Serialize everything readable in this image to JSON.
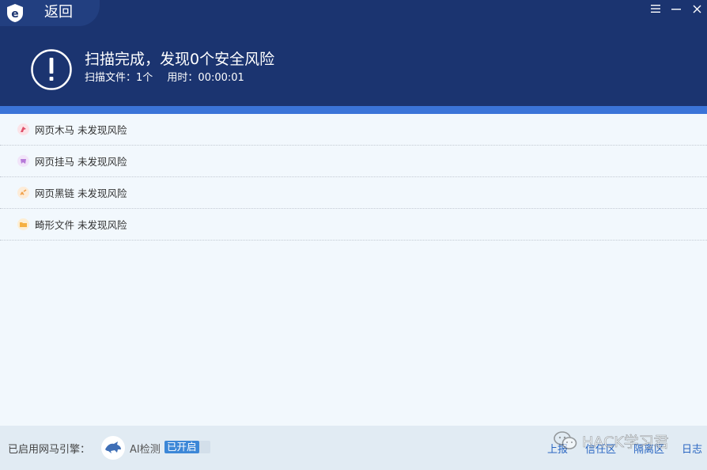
{
  "header": {
    "back_label": "返回",
    "title": "扫描完成，发现0个安全风险",
    "scanned_files": "扫描文件：1个",
    "elapsed": "用时：00:00:01"
  },
  "window_controls": [
    "menu-icon",
    "minimize-icon",
    "close-icon"
  ],
  "items": [
    {
      "name": "网页木马",
      "status": "未发现风险",
      "icon": "trojan-icon",
      "color": "#e0506a"
    },
    {
      "name": "网页挂马",
      "status": "未发现风险",
      "icon": "web-hang-icon",
      "color": "#b67ad8"
    },
    {
      "name": "网页黑链",
      "status": "未发现风险",
      "icon": "black-link-icon",
      "color": "#f0a04a"
    },
    {
      "name": "畸形文件",
      "status": "未发现风险",
      "icon": "malformed-file-icon",
      "color": "#f5b041"
    }
  ],
  "footer": {
    "engine_label": "已启用网马引擎：",
    "ai_label": "AI检测",
    "ai_status": "已开启",
    "links": [
      "上报",
      "信任区",
      "隔离区",
      "日志"
    ]
  },
  "watermark": {
    "text": "HACK学习君"
  },
  "colors": {
    "header_bg": "#1b3470",
    "accent": "#3b74d8",
    "link": "#2a66c2"
  }
}
